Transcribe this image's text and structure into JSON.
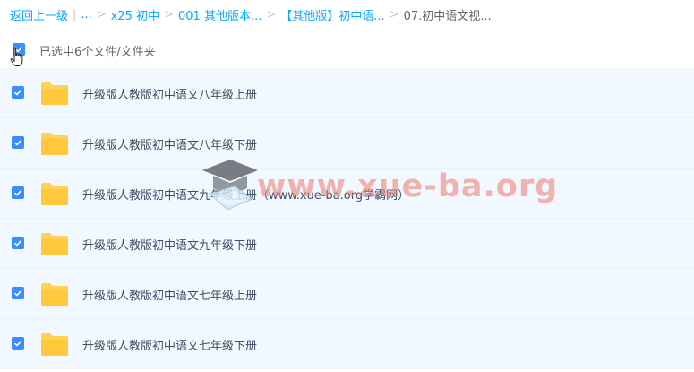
{
  "breadcrumb": {
    "back": "返回上一级",
    "divider": "|",
    "ellipsis": "...",
    "sep": ">",
    "items": [
      "x25 初中",
      "001 其他版本...",
      "【其他版】初中语...",
      "07.初中语文视..."
    ]
  },
  "selection": {
    "text": "已选中6个文件/文件夹",
    "checked": true
  },
  "files": [
    {
      "name": "升级版人教版初中语文八年级上册",
      "icon": "folder-icon",
      "checked": true
    },
    {
      "name": "升级版人教版初中语文八年级下册",
      "icon": "folder-icon",
      "checked": true
    },
    {
      "name": "升级版人教版初中语文九年级上册（www.xue-ba.org学霸网）",
      "icon": "folder-icon",
      "checked": true
    },
    {
      "name": "升级版人教版初中语文九年级下册",
      "icon": "folder-icon",
      "checked": true
    },
    {
      "name": "升级版人教版初中语文七年级上册",
      "icon": "folder-icon",
      "checked": true
    },
    {
      "name": "升级版人教版初中语文七年级下册",
      "icon": "folder-icon",
      "checked": true
    }
  ],
  "watermark": {
    "text": "www.xue-ba.org"
  },
  "colors": {
    "accent": "#09aaff",
    "checkbox": "#3b8cff",
    "row_bg": "#f2f8ff",
    "folder": "#ffd256"
  }
}
